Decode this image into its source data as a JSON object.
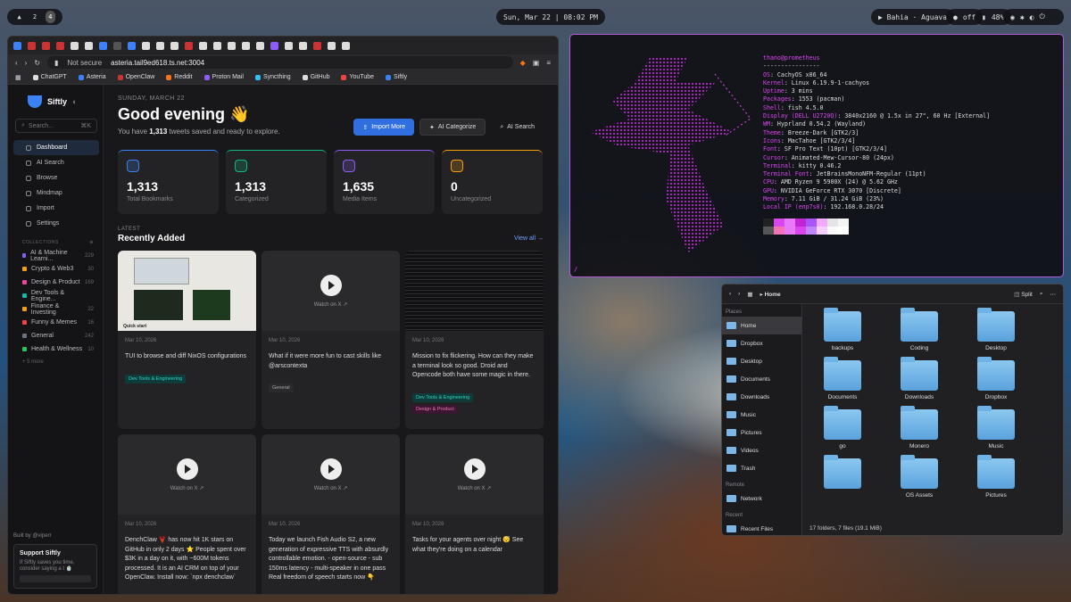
{
  "topbar": {
    "workspaces": [
      "2",
      "4"
    ],
    "clock": "Sun, Mar 22 | 08:02 PM",
    "media": "▶ Bahia · Aguava",
    "dnd": "off",
    "battery": "48%"
  },
  "browser": {
    "url_prefix": "Not secure",
    "url": "asteria.tail9ed618.ts.net:3004",
    "bookmarks": [
      "ChatGPT",
      "Asteria",
      "OpenClaw",
      "Reddit",
      "Proton Mail",
      "Syncthing",
      "GitHub",
      "YouTube",
      "Siftly"
    ]
  },
  "sidebar": {
    "brand": "Siftly",
    "search_placeholder": "Search...",
    "shortcut": "⌘K",
    "nav": [
      "Dashboard",
      "AI Search",
      "Browse",
      "Mindmap",
      "Import",
      "Settings"
    ],
    "collections_header": "COLLECTIONS",
    "collections": [
      {
        "name": "AI & Machine Learni...",
        "count": "229",
        "color": "#8b5cf6"
      },
      {
        "name": "Crypto & Web3",
        "count": "30",
        "color": "#f59e0b"
      },
      {
        "name": "Design & Product",
        "count": "169",
        "color": "#ec4899"
      },
      {
        "name": "Dev Tools & Engine...",
        "count": "",
        "color": "#14b8a6"
      },
      {
        "name": "Finance & Investing",
        "count": "22",
        "color": "#f59e0b"
      },
      {
        "name": "Funny & Memes",
        "count": "16",
        "color": "#ef4444"
      },
      {
        "name": "General",
        "count": "242",
        "color": "#6b7280"
      },
      {
        "name": "Health & Wellness",
        "count": "10",
        "color": "#22c55e"
      }
    ],
    "more": "+ 5 more",
    "built_by": "Built by @viperr",
    "support_title": "Support Siftly",
    "support_text": "If Siftly saves you time, consider saying a t 🍵"
  },
  "main": {
    "date": "SUNDAY, MARCH 22",
    "greeting": "Good evening 👋",
    "sub_pre": "You have ",
    "sub_count": "1,313",
    "sub_post": " tweets saved and ready to explore.",
    "actions": [
      "Import More",
      "AI Categorize",
      "AI Search"
    ],
    "stats": [
      {
        "value": "1,313",
        "label": "Total Bookmarks",
        "color": "#3b82f6"
      },
      {
        "value": "1,313",
        "label": "Categorized",
        "color": "#10b981"
      },
      {
        "value": "1,635",
        "label": "Media Items",
        "color": "#8b5cf6"
      },
      {
        "value": "0",
        "label": "Uncategorized",
        "color": "#f59e0b"
      }
    ],
    "latest": "LATEST",
    "recent": "Recently Added",
    "view_all": "View all →",
    "tiles": [
      {
        "date": "Mar 10, 2026",
        "text": "TUI to browse and diff NixOS configurations",
        "tags": [
          "Dev Tools & Engineering"
        ],
        "thumb": "doc",
        "watch": ""
      },
      {
        "date": "Mar 10, 2026",
        "text": "What if it were more fun to cast skills like @arscontexta",
        "tags": [
          "General"
        ],
        "thumb": "video",
        "watch": "Watch on X ↗"
      },
      {
        "date": "Mar 10, 2026",
        "text": "Mission to fix flickering. How can they make a terminal look so good. Droid and Opencode both have some magic in there.",
        "tags": [
          "Dev Tools & Engineering",
          "Design & Product"
        ],
        "thumb": "code",
        "watch": ""
      },
      {
        "date": "Mar 10, 2026",
        "text": "DenchClaw 🦞 has now hit 1K stars on GitHub in only 2 days ⭐ People spent over $3K in a day on it, with ~600M tokens processed. It is an AI CRM on top of your OpenClaw. Install now: `npx denchclaw`",
        "tags": [],
        "thumb": "video",
        "watch": "Watch on X ↗"
      },
      {
        "date": "Mar 10, 2026",
        "text": "Today we launch Fish Audio S2, a new generation of expressive TTS with absurdly controllable emotion. - open-source - sub 150ms latency - multi-speaker in one pass Real freedom of speech starts now 👇",
        "tags": [],
        "thumb": "video",
        "watch": "Watch on X ↗"
      },
      {
        "date": "Mar 10, 2026",
        "text": "Tasks for your agents over night 😴 See what they're doing on a calendar",
        "tags": [],
        "thumb": "video",
        "watch": "Watch on X ↗"
      }
    ]
  },
  "terminal": {
    "user": "thano@prometheus",
    "sep": "----------------",
    "rows": [
      [
        "OS",
        "CachyOS x86_64"
      ],
      [
        "Kernel",
        "Linux 6.19.9-1-cachyos"
      ],
      [
        "Uptime",
        "3 mins"
      ],
      [
        "Packages",
        "1553 (pacman)"
      ],
      [
        "Shell",
        "fish 4.5.0"
      ],
      [
        "Display (DELL U2720Q)",
        "3840x2160 @ 1.5x in 27\", 60 Hz [External]"
      ],
      [
        "WM",
        "Hyprland 0.54.2 (Wayland)"
      ],
      [
        "Theme",
        "Breeze-Dark [GTK2/3]"
      ],
      [
        "Icons",
        "MacTahoe [GTK2/3/4]"
      ],
      [
        "Font",
        "SF Pro Text (10pt) [GTK2/3/4]"
      ],
      [
        "Cursor",
        "Animated-Mew-Cursor-80 (24px)"
      ],
      [
        "Terminal",
        "kitty 0.46.2"
      ],
      [
        "Terminal Font",
        "JetBrainsMonoNFM-Regular (11pt)"
      ],
      [
        "CPU",
        "AMD Ryzen 9 5900X (24) @ 5.62 GHz"
      ],
      [
        "GPU",
        "NVIDIA GeForce RTX 3070 [Discrete]"
      ],
      [
        "Memory",
        "7.11 GiB / 31.24 GiB (23%)"
      ],
      [
        "Local IP (enp7s0)",
        "192.168.0.28/24"
      ]
    ],
    "swatches": [
      "#222",
      "#d946ef",
      "#e879f9",
      "#c026d3",
      "#a855f7",
      "#f0abfc",
      "#e5e5e5",
      "#f5f5f5",
      "#555",
      "#f472b6",
      "#e879f9",
      "#d946ef",
      "#c084fc",
      "#f5d0fe",
      "#fafafa",
      "#ffffff"
    ]
  },
  "files": {
    "location": "Home",
    "split": "Split",
    "places_header": "Places",
    "places": [
      "Home",
      "Dropbox",
      "Desktop",
      "Documents",
      "Downloads",
      "Music",
      "Pictures",
      "Videos",
      "Trash"
    ],
    "remote_header": "Remote",
    "remote": [
      "Network"
    ],
    "recent_header": "Recent",
    "recent": [
      "Recent Files"
    ],
    "folders": [
      "backups",
      "Coding",
      "Desktop",
      "Documents",
      "Downloads",
      "Dropbox",
      "go",
      "Monero",
      "Music",
      "",
      "OS Assets",
      "Pictures"
    ],
    "status": "17 folders, 7 files (19.1 MiB)"
  }
}
